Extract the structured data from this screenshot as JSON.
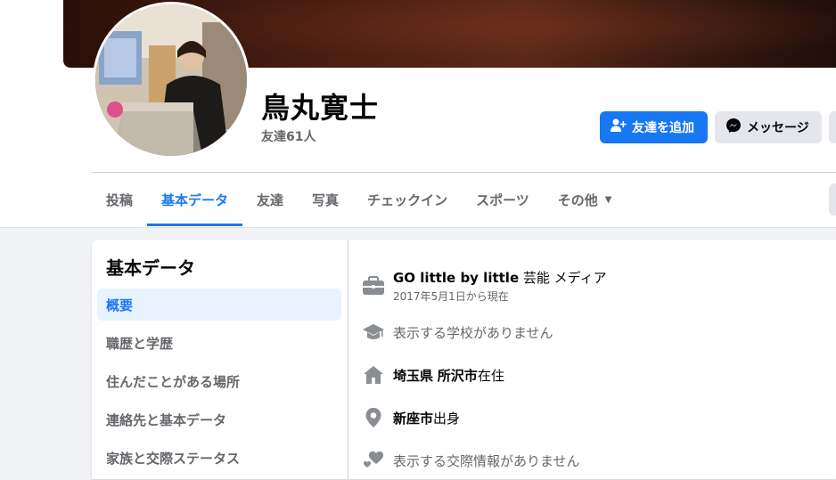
{
  "profile": {
    "name": "鳥丸寛士",
    "friends_count": "友達61人"
  },
  "actions": {
    "add_friend": "友達を追加",
    "message": "メッセージ"
  },
  "tabs": [
    {
      "label": "投稿"
    },
    {
      "label": "基本データ",
      "active": true
    },
    {
      "label": "友達"
    },
    {
      "label": "写真"
    },
    {
      "label": "チェックイン"
    },
    {
      "label": "スポーツ"
    },
    {
      "label": "その他"
    }
  ],
  "about": {
    "title": "基本データ",
    "menu": [
      {
        "label": "概要",
        "active": true
      },
      {
        "label": "職歴と学歴"
      },
      {
        "label": "住んだことがある場所"
      },
      {
        "label": "連絡先と基本データ"
      },
      {
        "label": "家族と交際ステータス"
      }
    ],
    "overview": {
      "work": {
        "org": "GO little by little",
        "rest": " 芸能 メディア",
        "since": "2017年5月1日から現在",
        "icon": "briefcase-icon"
      },
      "school": {
        "text": "表示する学校がありません",
        "icon": "graduation-cap-icon"
      },
      "lives": {
        "pref": "埼玉県",
        "city": "所沢市",
        "suffix": "在住",
        "icon": "home-icon"
      },
      "from": {
        "city": "新座市",
        "suffix": "出身",
        "icon": "location-pin-icon"
      },
      "relationship": {
        "text": "表示する交際情報がありません",
        "icon": "hearts-icon"
      }
    }
  },
  "colors": {
    "accent": "#1877f2",
    "muted_text": "#65676b",
    "page_bg": "#f0f2f5"
  }
}
